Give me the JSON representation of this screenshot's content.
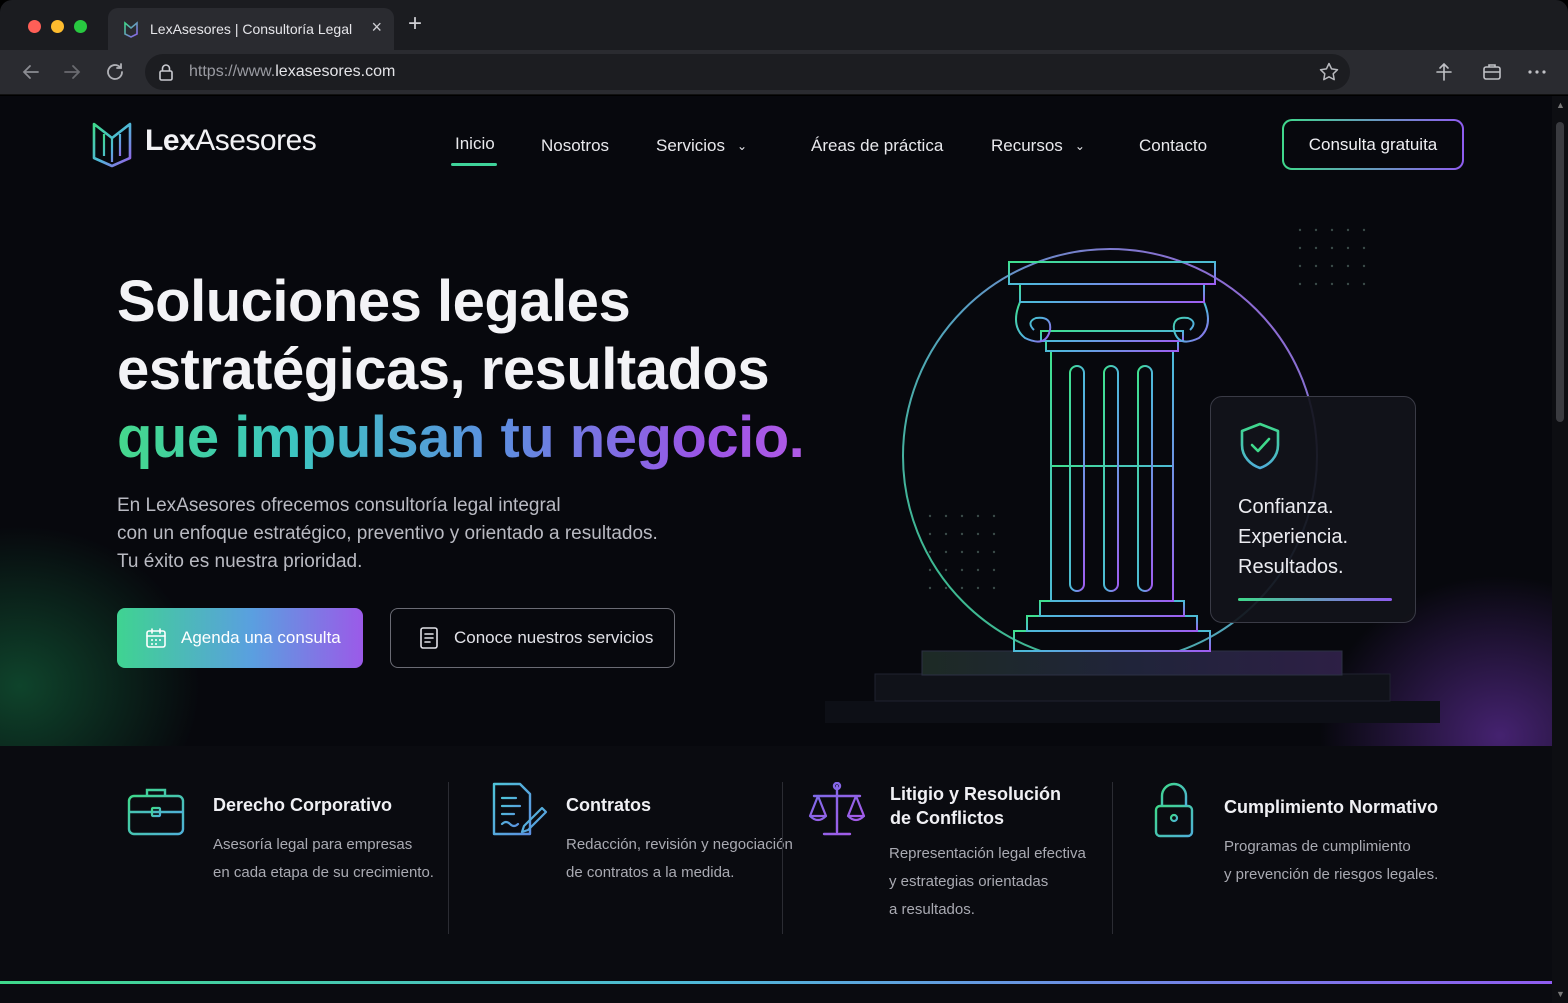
{
  "browser": {
    "tab_title": "LexAsesores | Consultoría Legal",
    "url_scheme": "https://www.",
    "url_host": "lexasesores.com"
  },
  "header": {
    "logo_bold": "Lex",
    "logo_light": "Asesores",
    "nav": [
      {
        "label": "Inicio"
      },
      {
        "label": "Nosotros"
      },
      {
        "label": "Servicios"
      },
      {
        "label": "Áreas de práctica"
      },
      {
        "label": "Recursos"
      },
      {
        "label": "Contacto"
      }
    ],
    "cta": "Consulta gratuita"
  },
  "hero": {
    "title_line1": "Soluciones legales",
    "title_line2": "estratégicas, resultados",
    "title_line3": "que impulsan tu negocio.",
    "desc_line1": "En LexAsesores ofrecemos consultoría legal integral",
    "desc_line2": "con un enfoque estratégico, preventivo y orientado a resultados.",
    "desc_line3": "Tu éxito es nuestra prioridad.",
    "primary_button": "Agenda una consulta",
    "secondary_button": "Conoce nuestros servicios"
  },
  "trust_card": {
    "line1": "Confianza.",
    "line2": "Experiencia.",
    "line3": "Resultados."
  },
  "services": [
    {
      "icon": "briefcase-icon",
      "title": [
        "Derecho Corporativo"
      ],
      "desc": [
        "Asesoría legal para empresas",
        "en cada etapa de su crecimiento."
      ]
    },
    {
      "icon": "contract-icon",
      "title": [
        "Contratos"
      ],
      "desc": [
        "Redacción, revisión y negociación",
        "de contratos a la medida."
      ]
    },
    {
      "icon": "scales-icon",
      "title": [
        "Litigio y Resolución",
        "de Conflictos"
      ],
      "desc": [
        "Representación legal efectiva",
        "y estrategias orientadas",
        "a resultados."
      ]
    },
    {
      "icon": "lock-icon",
      "title": [
        "Cumplimiento Normativo"
      ],
      "desc": [
        "Programas de cumplimiento",
        "y prevención de riesgos legales."
      ]
    }
  ],
  "colors": {
    "accent_green": "#3fd98b",
    "accent_purple": "#8f5cf0",
    "background": "#07080d"
  }
}
